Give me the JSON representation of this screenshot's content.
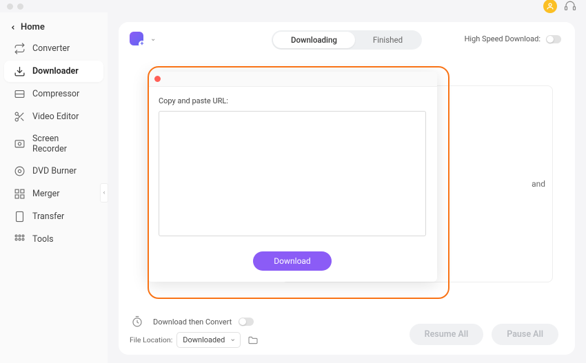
{
  "sidebar": {
    "home": "Home",
    "items": [
      {
        "label": "Converter"
      },
      {
        "label": "Downloader"
      },
      {
        "label": "Compressor"
      },
      {
        "label": "Video Editor"
      },
      {
        "label": "Screen Recorder"
      },
      {
        "label": "DVD Burner"
      },
      {
        "label": "Merger"
      },
      {
        "label": "Transfer"
      },
      {
        "label": "Tools"
      }
    ]
  },
  "tabs": {
    "downloading": "Downloading",
    "finished": "Finished"
  },
  "hsd_label": "High Speed Download:",
  "dialog": {
    "label": "Copy and paste URL:",
    "value": "",
    "button": "Download"
  },
  "drop_hint_tail": "and",
  "footer": {
    "convert_label": "Download then Convert",
    "location_label": "File Location:",
    "location_value": "Downloaded",
    "resume": "Resume All",
    "pause": "Pause All"
  }
}
